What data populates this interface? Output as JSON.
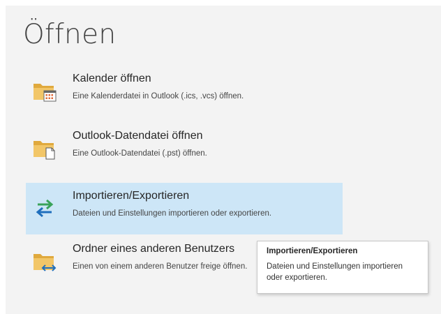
{
  "page": {
    "title": "Öffnen"
  },
  "options": [
    {
      "title": "Kalender öffnen",
      "description": "Eine Kalenderdatei in Outlook (.ics, .vcs) öffnen.",
      "icon": "calendar-folder-icon"
    },
    {
      "title": "Outlook-Datendatei öffnen",
      "description": "Eine Outlook-Datendatei (.pst) öffnen.",
      "icon": "data-file-folder-icon"
    },
    {
      "title": "Importieren/Exportieren",
      "description": "Dateien und Einstellungen importieren oder exportieren.",
      "icon": "import-export-arrows-icon",
      "selected": true
    },
    {
      "title": "Ordner eines anderen Benutzers",
      "description": "Einen von einem anderen Benutzer freige öffnen.",
      "icon": "shared-folder-icon"
    }
  ],
  "tooltip": {
    "title": "Importieren/Exportieren",
    "body": "Dateien und Einstellungen importieren oder exportieren."
  },
  "colors": {
    "selected_background": "#cde6f7",
    "folder": "#e8b44c",
    "arrow_green": "#3aa35a",
    "arrow_blue": "#1f6fbd"
  }
}
